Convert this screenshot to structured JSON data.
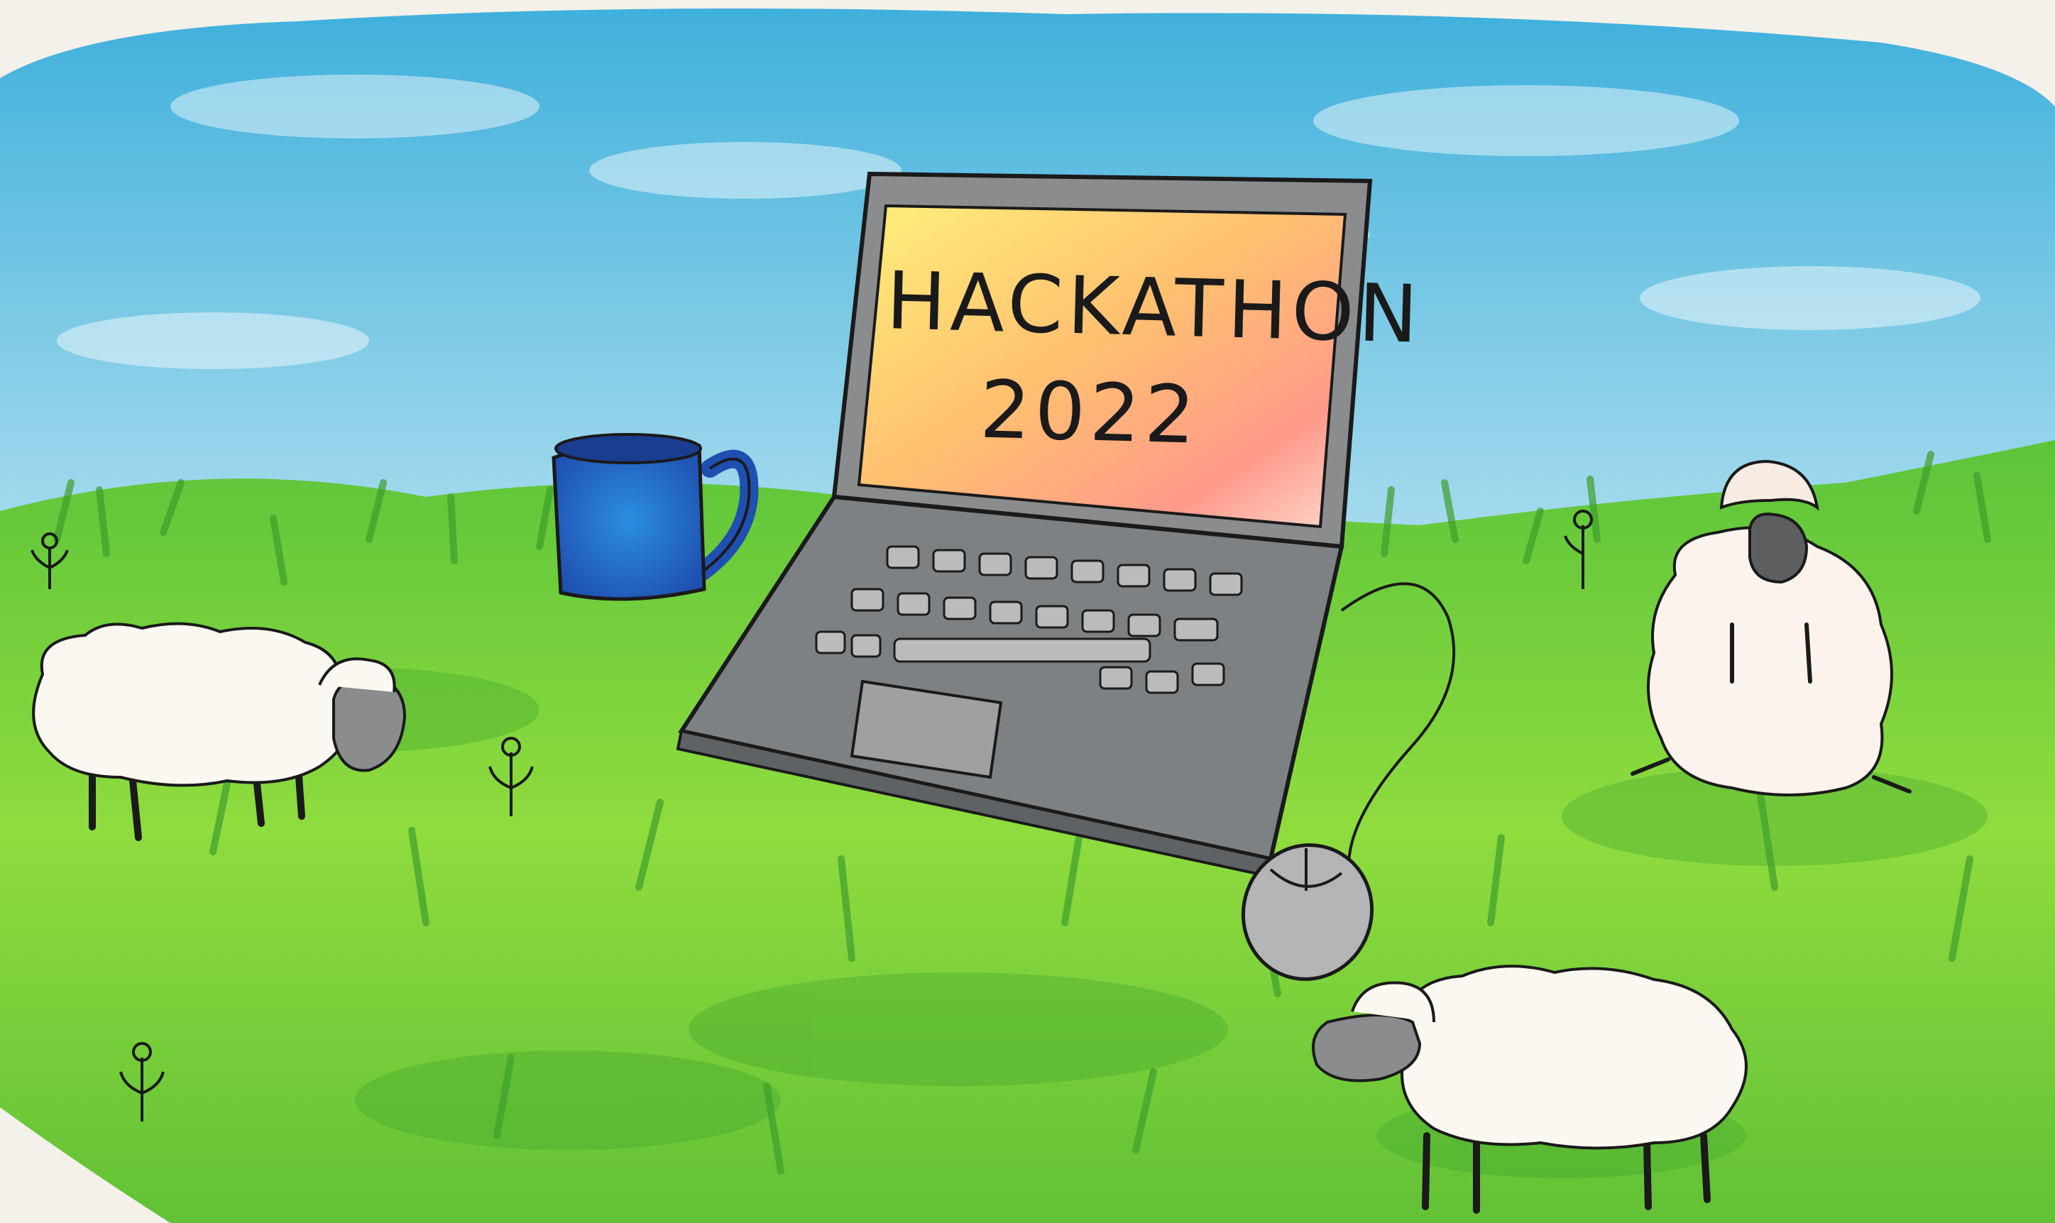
{
  "laptop": {
    "screen_line1": "HACKATHON",
    "screen_line2": "2022"
  },
  "colors": {
    "paper": "#f4f1ea",
    "sky": "#58bfe0",
    "grass": "#7dd63a",
    "grass_dark": "#3f9e2c",
    "laptop_body": "#8a8c8e",
    "mug": "#2f66c6",
    "sheep": "#fbf8f2",
    "outline": "#1a1a1a"
  },
  "icons": [
    "laptop-icon",
    "mug-icon",
    "mouse-icon",
    "sheep-icon",
    "flower-icon"
  ]
}
